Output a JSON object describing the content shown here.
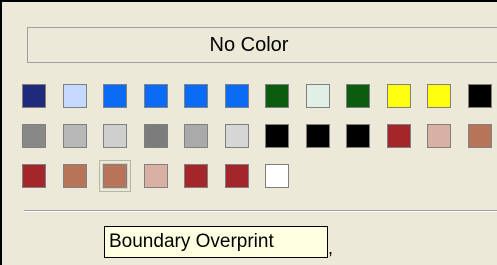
{
  "no_color_label": "No Color",
  "tooltip_text": "Boundary Overprint",
  "tooltip_tail": ",",
  "swatch_rows": [
    [
      "#1f2a7a",
      "#c5d8ff",
      "#0a6cf5",
      "#0a6cf5",
      "#0a6cf5",
      "#0a6cf5",
      "#0c5c10",
      "#dff0e6",
      "#0c5c10",
      "#ffff10",
      "#ffff10",
      "#000000"
    ],
    [
      "#888888",
      "#b8b8b8",
      "#cfcfcf",
      "#7c7c7c",
      "#aaaaaa",
      "#d6d6d6",
      "#000000",
      "#000000",
      "#000000",
      "#a4262a",
      "#d9b0a4",
      "#b87458"
    ],
    [
      "#a4262a",
      "#b87458",
      "#b87458",
      "#d9b0a4",
      "#a4262a",
      "#a4262a",
      "#ffffff"
    ]
  ],
  "selected_swatch": {
    "row": 2,
    "col": 2
  }
}
